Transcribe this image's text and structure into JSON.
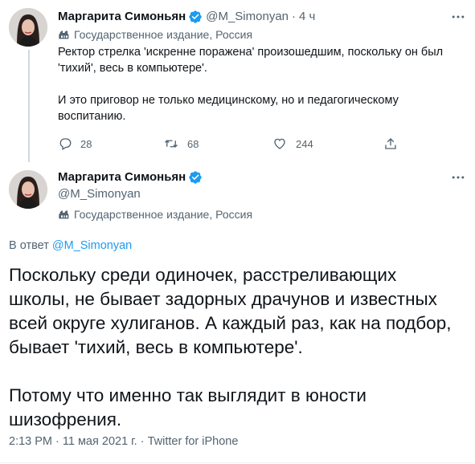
{
  "colors": {
    "text": "#0f1419",
    "secondary": "#536471",
    "link": "#1d9bf0",
    "verified": "#1d9bf0",
    "thread_line": "#cfd9de"
  },
  "tweet1": {
    "author_name": "Маргарита Симоньян",
    "handle": "@M_Simonyan",
    "separator": "·",
    "time": "4 ч",
    "label_icon": "state-media-icon",
    "label": "Государственное издание, Россия",
    "text": "Ректор стрелка 'искренне поражена' произошедшим, поскольку он был\n'тихий', весь в компьютере'.\n\nИ это приговор не только медицинскому, но и педагогическому\nвоспитанию.",
    "replies": "28",
    "retweets": "68",
    "likes": "244"
  },
  "tweet2": {
    "author_name": "Маргарита Симоньян",
    "handle": "@M_Simonyan",
    "label_icon": "state-media-icon",
    "label": "Государственное издание, Россия",
    "reply_prefix": "В ответ ",
    "reply_handle": "@M_Simonyan",
    "text": "Поскольку среди одиночек, расстреливающих\nшколы, не бывает задорных драчунов и известных\nвсей округе хулиганов. А каждый раз, как на подбор,\nбывает 'тихий, весь в компьютере'.\n\nПотому что именно так выглядит в юности\nшизофрения.",
    "timestamp": "2:13 PM · 11 мая 2021 г. · Twitter for iPhone"
  }
}
